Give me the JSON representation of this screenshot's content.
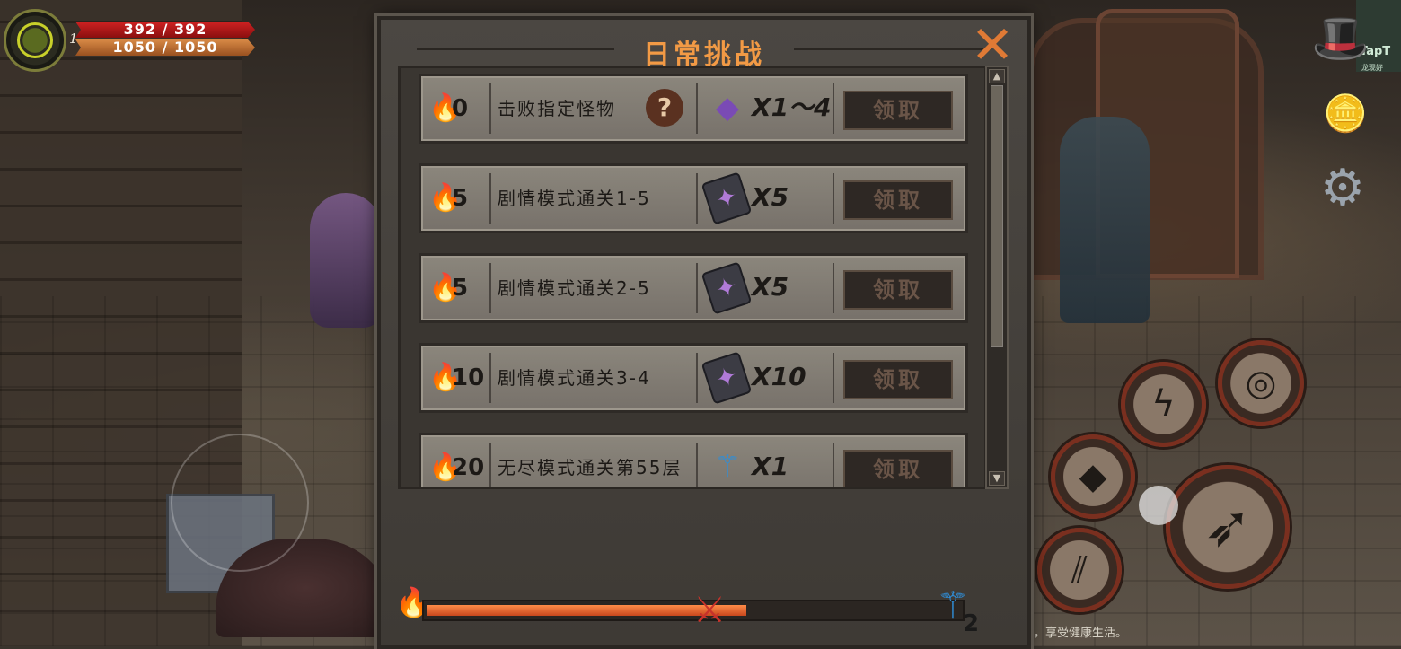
{
  "hud": {
    "level": "1",
    "hp": "392 / 392",
    "mp": "1050 / 1050"
  },
  "panel": {
    "title": "日常挑战",
    "close_icon": "close-icon"
  },
  "tasks": [
    {
      "points": "0",
      "name": "击败指定怪物",
      "has_help": true,
      "help_symbol": "?",
      "reward_icon": "crystal-icon",
      "quantity": "X1～4",
      "claim_label": "领取"
    },
    {
      "points": "5",
      "name": "剧情模式通关1-5",
      "has_help": false,
      "reward_icon": "book-icon",
      "quantity": "X5",
      "claim_label": "领取"
    },
    {
      "points": "5",
      "name": "剧情模式通关2-5",
      "has_help": false,
      "reward_icon": "book-icon",
      "quantity": "X5",
      "claim_label": "领取"
    },
    {
      "points": "10",
      "name": "剧情模式通关3-4",
      "has_help": false,
      "reward_icon": "book-icon",
      "quantity": "X10",
      "claim_label": "领取"
    },
    {
      "points": "20",
      "name": "无尽模式通关第55层",
      "has_help": false,
      "reward_icon": "weapon-icon",
      "quantity": "X1",
      "claim_label": "领取"
    }
  ],
  "progress": {
    "fraction": 0.6,
    "end_reward_count": "2"
  },
  "health_notice": "间，享受健康生活。",
  "taptap": {
    "label": "TapT",
    "sub": "龙现好"
  },
  "colors": {
    "accent": "#f29a45",
    "progress": "#e8662a",
    "hp": "#c81e1e",
    "mp": "#c8783a"
  }
}
